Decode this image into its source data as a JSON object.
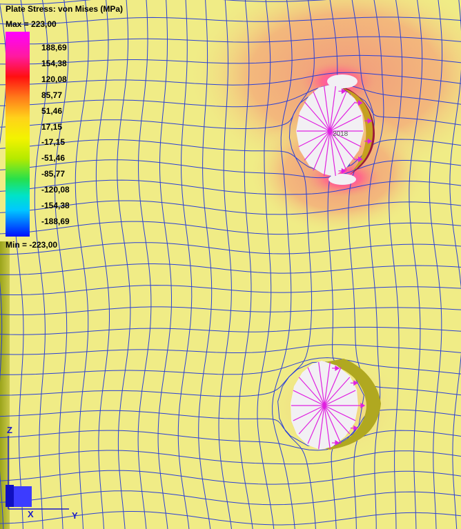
{
  "legend": {
    "title": "Plate Stress: von Mises (MPa)",
    "max_label": "Max = 223,00",
    "min_label": "Min = -223,00",
    "ticks": [
      "188,69",
      "154,38",
      "120,08",
      "85,77",
      "51,46",
      "17,15",
      "-17,15",
      "-51,46",
      "-85,77",
      "-120,08",
      "-154,38",
      "-188,69"
    ]
  },
  "node_label": "2018",
  "axes": {
    "z_label": "Z",
    "x_label": "X",
    "y_label": "Y"
  },
  "colors": {
    "mesh_lines": "#2a3fd6",
    "base_stress": "#f0ec86",
    "high_stress": "#f0a07a",
    "peak_stress": "#ff40d0",
    "hole_face": "#f2f0f4",
    "spokes": "#e020e0",
    "bolt_band": "#9a1a3a",
    "bolt_band_2": "#a69a10"
  }
}
